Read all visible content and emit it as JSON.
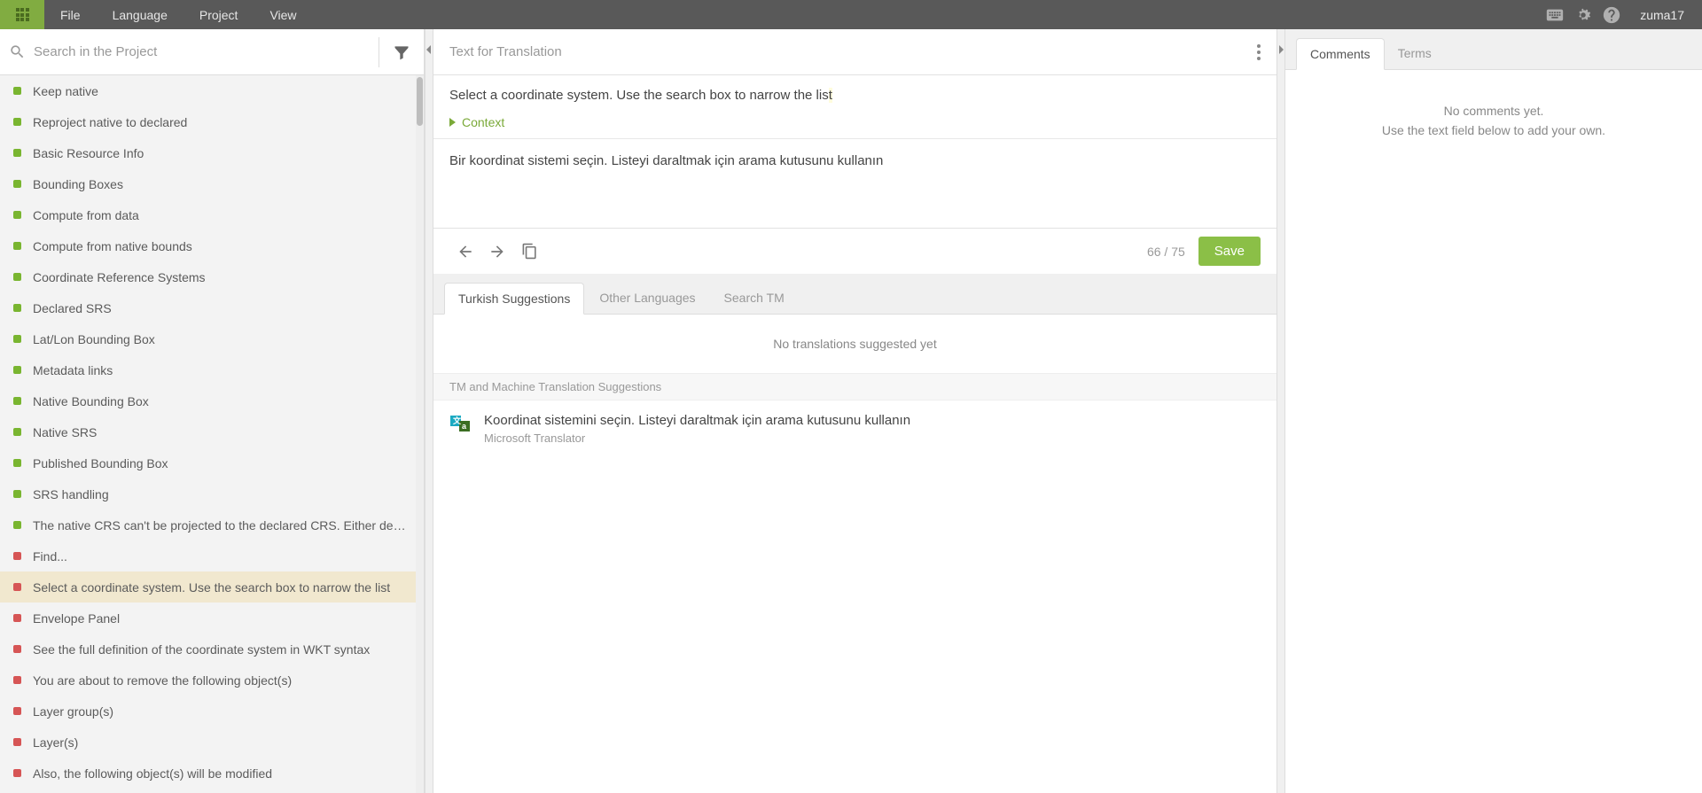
{
  "menu": {
    "file": "File",
    "language": "Language",
    "project": "Project",
    "view": "View"
  },
  "user": "zuma17",
  "search": {
    "placeholder": "Search in the Project"
  },
  "strings": [
    {
      "text": "Keep native",
      "status": "green",
      "selected": false
    },
    {
      "text": "Reproject native to declared",
      "status": "green",
      "selected": false
    },
    {
      "text": "Basic Resource Info",
      "status": "green",
      "selected": false
    },
    {
      "text": "Bounding Boxes",
      "status": "green",
      "selected": false
    },
    {
      "text": "Compute from data",
      "status": "green",
      "selected": false
    },
    {
      "text": "Compute from native bounds",
      "status": "green",
      "selected": false
    },
    {
      "text": "Coordinate Reference Systems",
      "status": "green",
      "selected": false
    },
    {
      "text": "Declared SRS",
      "status": "green",
      "selected": false
    },
    {
      "text": "Lat/Lon Bounding Box",
      "status": "green",
      "selected": false
    },
    {
      "text": "Metadata links",
      "status": "green",
      "selected": false
    },
    {
      "text": "Native Bounding Box",
      "status": "green",
      "selected": false
    },
    {
      "text": "Native SRS",
      "status": "green",
      "selected": false
    },
    {
      "text": "Published Bounding Box",
      "status": "green",
      "selected": false
    },
    {
      "text": "SRS handling",
      "status": "green",
      "selected": false
    },
    {
      "text": "The native CRS can't be projected to the declared CRS. Either decla...",
      "status": "green",
      "selected": false
    },
    {
      "text": "Find...",
      "status": "red",
      "selected": false
    },
    {
      "text": "Select a coordinate system. Use the search box to narrow the list",
      "status": "red",
      "selected": true
    },
    {
      "text": "Envelope Panel",
      "status": "red",
      "selected": false
    },
    {
      "text": "See the full definition of the coordinate system in WKT syntax",
      "status": "red",
      "selected": false
    },
    {
      "text": "You are about to remove the following object(s)",
      "status": "red",
      "selected": false
    },
    {
      "text": "Layer group(s)",
      "status": "red",
      "selected": false
    },
    {
      "text": "Layer(s)",
      "status": "red",
      "selected": false
    },
    {
      "text": "Also, the following object(s) will be modified",
      "status": "red",
      "selected": false
    }
  ],
  "center": {
    "title": "Text for Translation",
    "source": {
      "main": "Select a coordinate system. Use the search box to narrow the lis",
      "tail": "t"
    },
    "context_label": "Context",
    "target": "Bir koordinat sistemi seçin. Listeyi daraltmak için arama kutusunu kullanın",
    "counter": "66 / 75",
    "save": "Save",
    "tabs": {
      "turkish": "Turkish Suggestions",
      "other": "Other Languages",
      "tm": "Search TM"
    },
    "empty": "No translations suggested yet",
    "tm_header": "TM and Machine Translation Suggestions",
    "mt": {
      "text": "Koordinat sistemini seçin. Listeyi daraltmak için arama kutusunu kullanın",
      "provider": "Microsoft Translator"
    }
  },
  "right": {
    "tabs": {
      "comments": "Comments",
      "terms": "Terms"
    },
    "empty1": "No comments yet.",
    "empty2": "Use the text field below to add your own."
  }
}
